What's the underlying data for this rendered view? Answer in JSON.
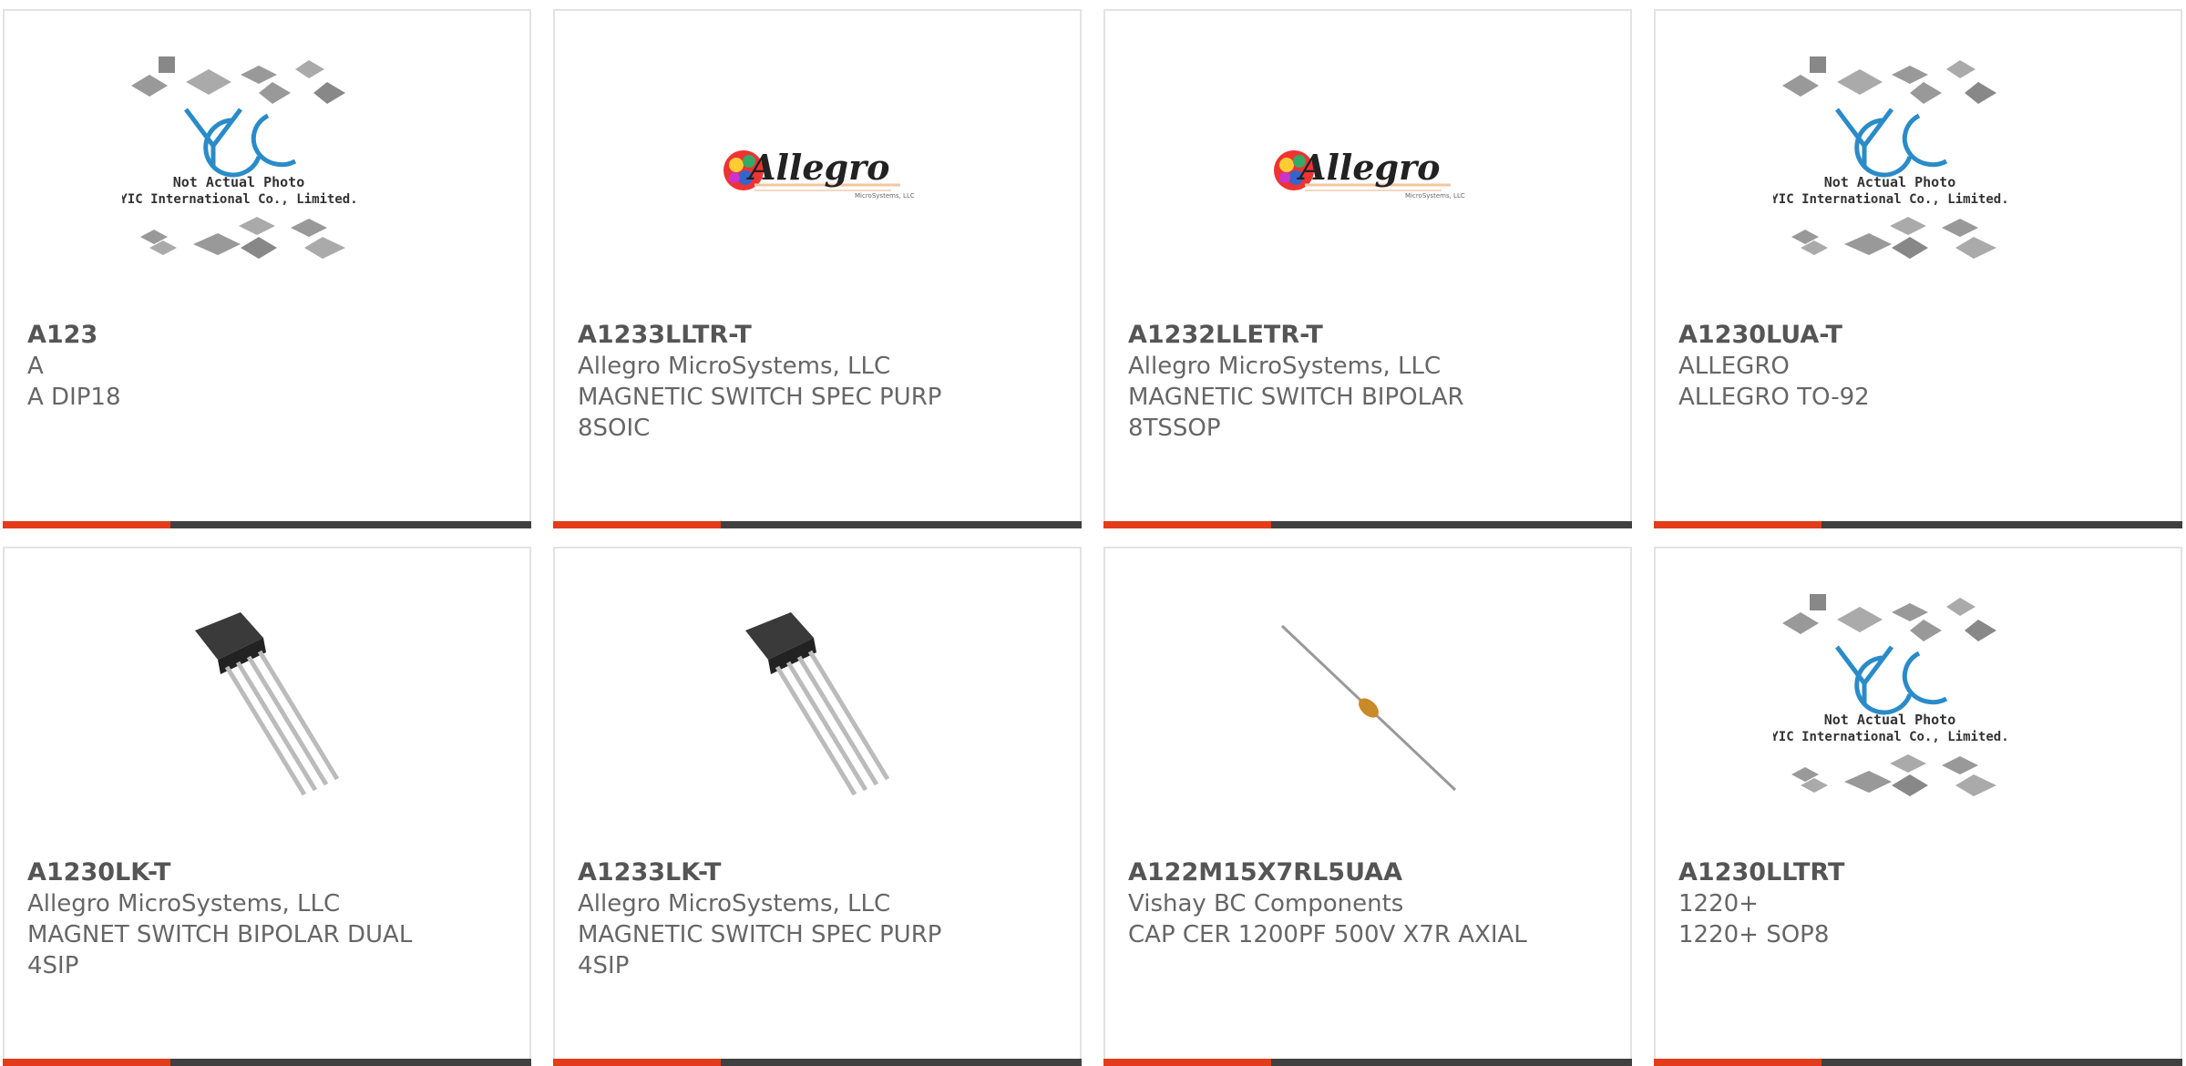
{
  "products": [
    {
      "part_number": "A123",
      "manufacturer": "A",
      "description": "A DIP18",
      "description2": "",
      "image": "yic-placeholder-icon",
      "yic": {
        "line1": "Not Actual Photo",
        "line2": "YIC International Co., Limited."
      }
    },
    {
      "part_number": "A1233LLTR-T",
      "manufacturer": "Allegro MicroSystems, LLC",
      "description": "MAGNETIC SWITCH SPEC PURP",
      "description2": "8SOIC",
      "image": "allegro-logo-icon",
      "logo": {
        "text": "Allegro",
        "sub": "MicroSystems, LLC"
      }
    },
    {
      "part_number": "A1232LLETR-T",
      "manufacturer": "Allegro MicroSystems, LLC",
      "description": "MAGNETIC SWITCH BIPOLAR",
      "description2": "8TSSOP",
      "image": "allegro-logo-icon",
      "logo": {
        "text": "Allegro",
        "sub": "MicroSystems, LLC"
      }
    },
    {
      "part_number": "A1230LUA-T",
      "manufacturer": "ALLEGRO",
      "description": "ALLEGRO TO-92",
      "description2": "",
      "image": "yic-placeholder-icon",
      "yic": {
        "line1": "Not Actual Photo",
        "line2": "YIC International Co., Limited."
      }
    },
    {
      "part_number": "A1230LK-T",
      "manufacturer": "Allegro MicroSystems, LLC",
      "description": "MAGNET SWITCH BIPOLAR DUAL",
      "description2": "4SIP",
      "image": "sip-4-package-icon"
    },
    {
      "part_number": "A1233LK-T",
      "manufacturer": "Allegro MicroSystems, LLC",
      "description": "MAGNETIC SWITCH SPEC PURP",
      "description2": "4SIP",
      "image": "sip-4-package-icon"
    },
    {
      "part_number": "A122M15X7RL5UAA",
      "manufacturer": "Vishay BC Components",
      "description": "CAP CER 1200PF 500V X7R AXIAL",
      "description2": "",
      "image": "axial-capacitor-icon"
    },
    {
      "part_number": "A1230LLTRT",
      "manufacturer": "1220+",
      "description": "1220+ SOP8",
      "description2": "",
      "image": "yic-placeholder-icon",
      "yic": {
        "line1": "Not Actual Photo",
        "line2": "YIC International Co., Limited."
      }
    }
  ],
  "colors": {
    "accent": "#e23c1a",
    "bar": "#404040",
    "border": "#e3e3e3",
    "text": "#555555",
    "yic_blue": "#2a8bc9"
  }
}
